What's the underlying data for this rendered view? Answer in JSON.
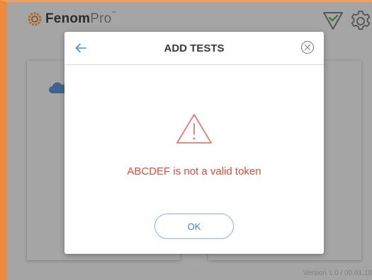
{
  "app": {
    "logo_bold": "Fenom",
    "logo_light": "Pro",
    "logo_tm": "™"
  },
  "header": {
    "status_icon": "check-triangle-icon",
    "settings_icon": "gear-icon"
  },
  "footer": {
    "version": "Version 1.0 / 00.01.18"
  },
  "dialog": {
    "title": "ADD TESTS",
    "back_icon": "arrow-left-icon",
    "close_icon": "close-circle-icon",
    "warning_icon": "warning-triangle-icon",
    "message": "ABCDEF is not a valid token",
    "ok_label": "OK"
  },
  "colors": {
    "accent_orange": "#f08a3c",
    "error_red": "#e8483a",
    "link_blue": "#3a7fd0",
    "success_green": "#3db36b"
  }
}
